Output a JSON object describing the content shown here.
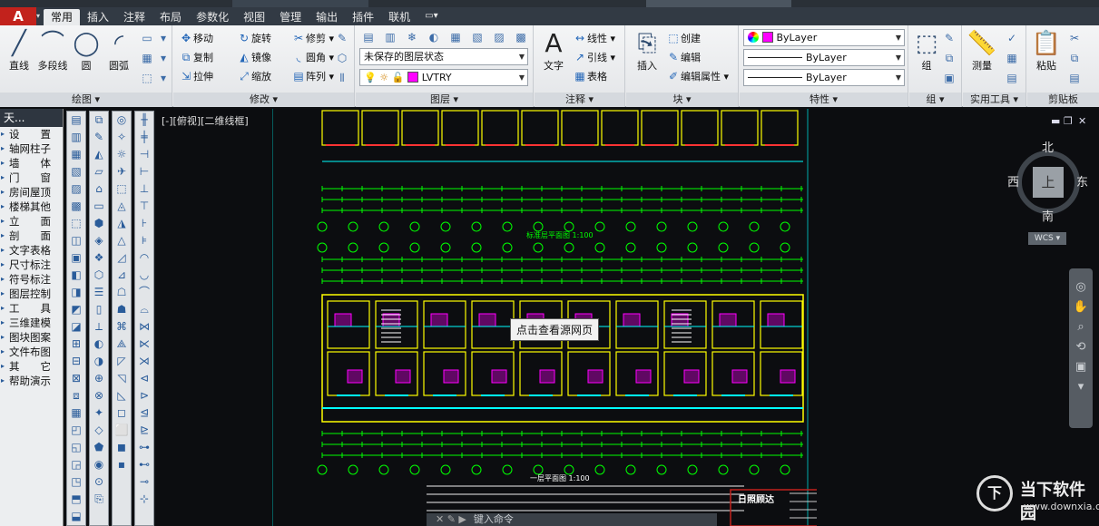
{
  "ribbon": {
    "app_button": "A",
    "tabs": [
      "常用",
      "插入",
      "注释",
      "布局",
      "参数化",
      "视图",
      "管理",
      "输出",
      "插件",
      "联机"
    ],
    "active_tab": "常用"
  },
  "panels": {
    "draw": {
      "footer": "绘图 ▾",
      "tools": [
        "直线",
        "多段线",
        "圆",
        "圆弧"
      ]
    },
    "modify": {
      "footer": "修改 ▾",
      "tools": [
        "移动",
        "旋转",
        "修剪",
        "复制",
        "镜像",
        "圆角",
        "拉伸",
        "缩放",
        "阵列"
      ]
    },
    "layers": {
      "footer": "图层 ▾",
      "state_combo": "未保存的图层状态",
      "layer_combo": "LVTRY"
    },
    "annotation": {
      "footer": "注释 ▾",
      "big_tool": "文字",
      "tools": [
        "线性",
        "引线",
        "表格"
      ]
    },
    "block": {
      "footer": "块 ▾",
      "big_tool": "插入",
      "tools": [
        "创建",
        "编辑",
        "编辑属性"
      ]
    },
    "properties": {
      "footer": "特性 ▾",
      "color_combo": "ByLayer",
      "linetype_combo": "ByLayer",
      "lineweight_combo": "ByLayer"
    },
    "group": {
      "footer": "组 ▾",
      "big_tool": "组"
    },
    "utilities": {
      "footer": "实用工具 ▾",
      "big_tool": "测量"
    },
    "clipboard": {
      "footer": "剪贴板",
      "big_tool": "粘贴"
    }
  },
  "left_panel": {
    "title": "天...",
    "items": [
      "设　　置",
      "轴网柱子",
      "墙　　体",
      "门　　窗",
      "房间屋顶",
      "楼梯其他",
      "立　　面",
      "剖　　面",
      "文字表格",
      "尺寸标注",
      "符号标注",
      "图层控制",
      "工　　具",
      "三维建模",
      "图块图案",
      "文件布图",
      "其　　它",
      "帮助演示"
    ]
  },
  "viewport": {
    "label": "[-][俯视][二维线框]",
    "compass": {
      "north": "北",
      "south": "南",
      "east": "东",
      "west": "西",
      "top": "上"
    },
    "ucs_label": "WCS"
  },
  "drawing_text": {
    "upper_plan_title": "标准层平面图 1:100",
    "lower_plan_title": "一层平面图 1:100",
    "title_block_name": "日照顾达"
  },
  "tooltip": "点击查看源网页",
  "command_line": {
    "placeholder": "键入命令"
  },
  "watermark": {
    "logo": "下",
    "name": "当下软件园",
    "url": "www.downxia.com"
  },
  "colors": {
    "canvas": "#0c0d10",
    "wall": "#ffff00",
    "dim": "#00ff00",
    "accent": "#ff00ff",
    "cyan": "#00ffff",
    "title": "#c2221c"
  }
}
